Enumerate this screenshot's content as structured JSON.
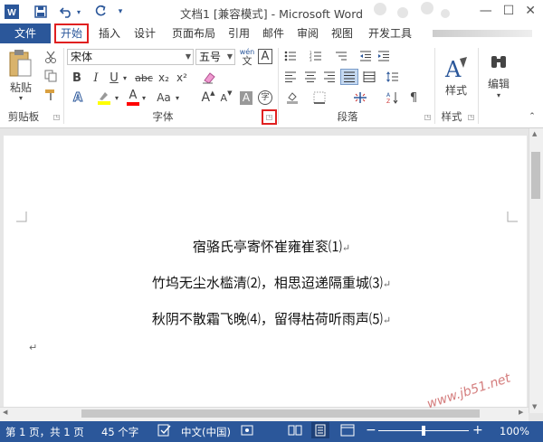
{
  "titlebar": {
    "title": "文档1 [兼容模式] - Microsoft Word",
    "app_icon": "W",
    "minimize": "—",
    "maximize": "☐",
    "close": "✕"
  },
  "tabs": {
    "file": "文件",
    "home": "开始",
    "insert": "插入",
    "design": "设计",
    "layout": "页面布局",
    "references": "引用",
    "mailings": "邮件",
    "review": "审阅",
    "view": "视图",
    "developer": "开发工具"
  },
  "ribbon": {
    "paste_label": "粘贴",
    "clipboard_label": "剪贴板",
    "font_label": "字体",
    "paragraph_label": "段落",
    "styles_label": "样式",
    "styles_button": "样式",
    "editing_button": "编辑",
    "font_name": "宋体",
    "font_size": "五号",
    "font_size_grow": "A",
    "font_size_shrink": "A",
    "bold": "B",
    "italic": "I",
    "underline": "U",
    "strike": "abc",
    "subscript": "x₂",
    "superscript": "x²",
    "char_case": "Aa",
    "font_color_letter": "A",
    "char_shade": "A",
    "enclose": "字",
    "wen": "wén",
    "wen_char": "文"
  },
  "document": {
    "line1": "宿骆氏亭寄怀崔雍崔衮⑴",
    "line2": "竹坞无尘水槛清⑵，相思迢递隔重城⑶",
    "line3": "秋阴不散霜飞晚⑷，留得枯荷听雨声⑸",
    "para_mark": "↵"
  },
  "status": {
    "page": "第 1 页，共 1 页",
    "words": "45 个字",
    "language": "中文(中国)",
    "zoom": "100%",
    "zoom_minus": "−",
    "zoom_plus": "+"
  },
  "watermark": "www.jb51.net",
  "colors": {
    "accent": "#2b579a",
    "highlight_box": "#e02020",
    "font_color_bar": "#ff0000",
    "highlight_bar": "#ffff00"
  }
}
